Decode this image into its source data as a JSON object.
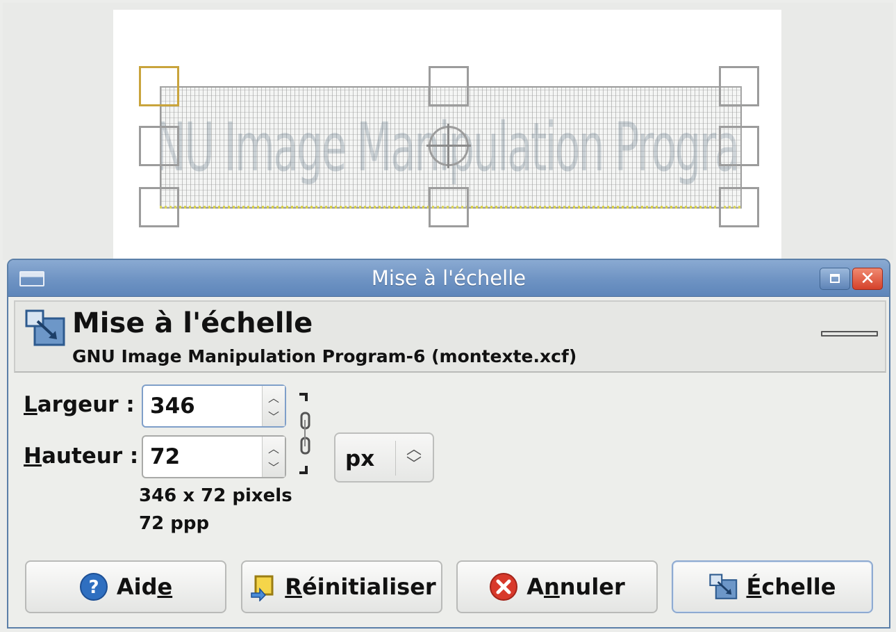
{
  "canvas": {
    "layer_text": "GNU Image Manipulation Program"
  },
  "window": {
    "title": "Mise à l'échelle"
  },
  "header": {
    "title": "Mise à l'échelle",
    "subtitle": "GNU Image Manipulation Program-6 (montexte.xcf)"
  },
  "form": {
    "width_label_mnemonic": "L",
    "width_label_rest": "argeur :",
    "width_value": "346",
    "height_label_mnemonic": "H",
    "height_label_rest": "auteur :",
    "height_value": "72",
    "unit": "px",
    "size_info": "346 x 72 pixels",
    "resolution_info": "72 ppp"
  },
  "buttons": {
    "help_pre": "Aid",
    "help_mnemonic": "e",
    "reset_mnemonic": "R",
    "reset_rest": "éinitialiser",
    "cancel_pre": "A",
    "cancel_mnemonic": "n",
    "cancel_rest": "nuler",
    "scale_mnemonic": "É",
    "scale_rest": "chelle"
  },
  "icons": {
    "window_menu": "window-menu-icon",
    "maximize": "maximize-icon",
    "close": "close-icon",
    "scale_tool": "scale-tool-icon",
    "chain": "chain-link-icon",
    "help": "help-icon",
    "reset": "reset-icon",
    "cancel": "cancel-icon"
  },
  "colors": {
    "titlebar": "#6e93c3",
    "active_handle": "#c9a43c",
    "cancel_red": "#d8392b",
    "help_blue": "#2f6fc0"
  }
}
